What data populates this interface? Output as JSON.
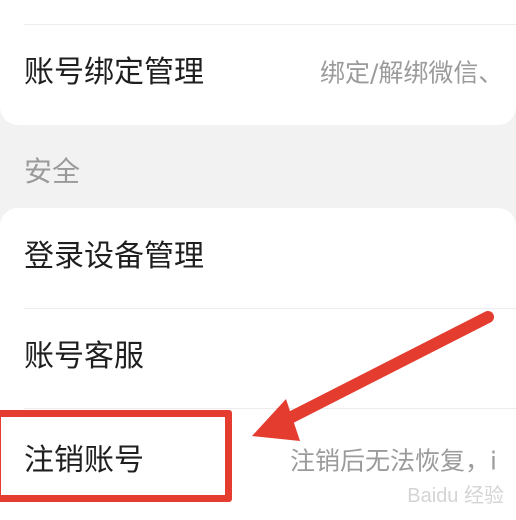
{
  "account_binding": {
    "title": "账号绑定管理",
    "description": "绑定/解绑微信、"
  },
  "security_section": {
    "title": "安全",
    "items": [
      {
        "title": "登录设备管理",
        "description": ""
      },
      {
        "title": "账号客服",
        "description": ""
      },
      {
        "title": "注销账号",
        "description": "注销后无法恢复，i"
      }
    ]
  },
  "annotation": {
    "highlight_color": "#e43d30",
    "arrow_color": "#e43d30"
  },
  "watermark": {
    "text": "Baidu 经验"
  }
}
